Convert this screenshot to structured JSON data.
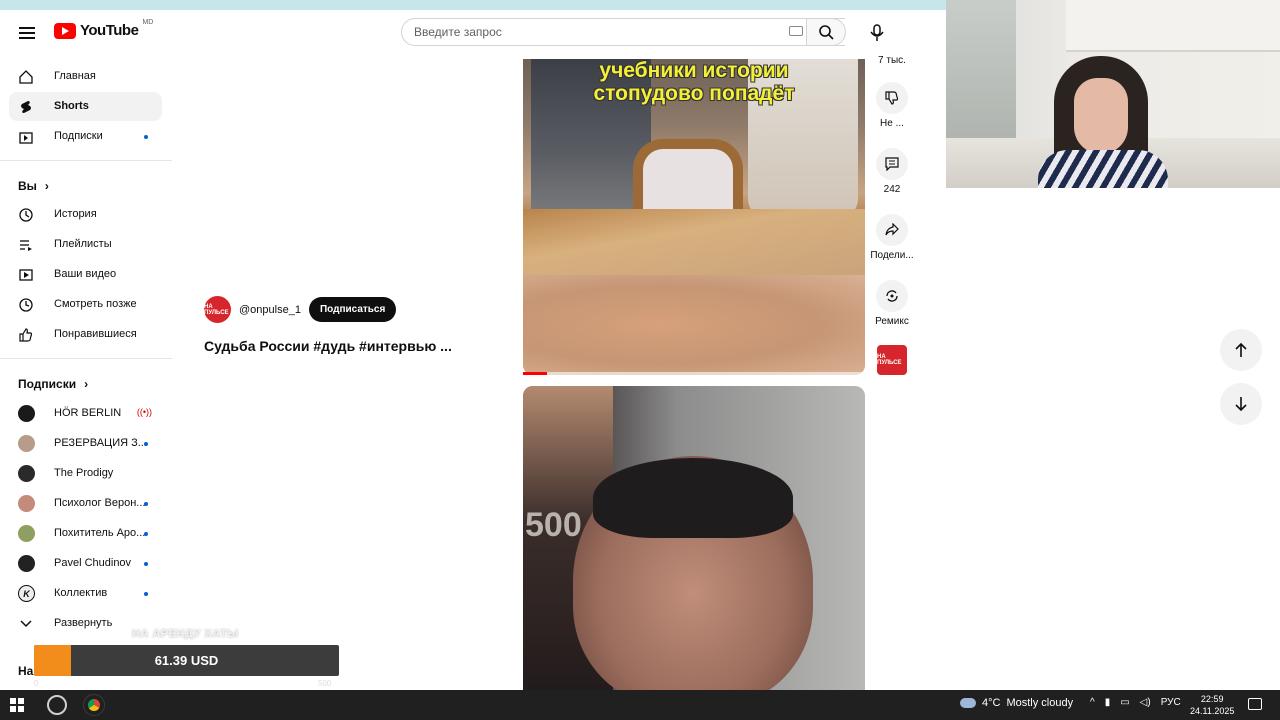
{
  "header": {
    "logo_text": "YouTube",
    "region": "MD",
    "search_placeholder": "Введите запрос"
  },
  "sidebar": {
    "main": [
      {
        "label": "Главная",
        "icon": "home-icon"
      },
      {
        "label": "Shorts",
        "icon": "shorts-icon",
        "active": true
      },
      {
        "label": "Подписки",
        "icon": "subscriptions-icon",
        "dot": true
      }
    ],
    "you_title": "Вы",
    "you": [
      {
        "label": "История",
        "icon": "history-icon"
      },
      {
        "label": "Плейлисты",
        "icon": "playlists-icon"
      },
      {
        "label": "Ваши видео",
        "icon": "your-videos-icon"
      },
      {
        "label": "Смотреть позже",
        "icon": "watch-later-icon"
      },
      {
        "label": "Понравившиеся",
        "icon": "liked-icon"
      }
    ],
    "subs_title": "Подписки",
    "subs": [
      {
        "label": "HÖR BERLIN",
        "live": true,
        "color": "#1a1a1a"
      },
      {
        "label": "РЕЗЕРВАЦИЯ З...",
        "dot": true,
        "color": "#b79c8a"
      },
      {
        "label": "The Prodigy",
        "color": "#2a2a2a"
      },
      {
        "label": "Психолог Верон...",
        "dot": true,
        "color": "#c48a7a"
      },
      {
        "label": "Похититель Аро...",
        "dot": true,
        "color": "#8ea060"
      },
      {
        "label": "Pavel Chudinov",
        "dot": true,
        "color": "#222222"
      },
      {
        "label": "Коллектив",
        "dot": true,
        "color": "#eeeeee"
      }
    ],
    "expand_label": "Развернуть",
    "next_section_partial": "На"
  },
  "short": {
    "channel": "@onpulse_1",
    "subscribe": "Подписаться",
    "title": "Судьба России #дудь #интервью ...",
    "caption_line1": "учебники истории",
    "caption_line2": "стопудово попадёт",
    "progress": 0.07,
    "overlay_number": "500",
    "channel_logo_text": "НА ПУЛЬСЕ"
  },
  "actions": {
    "likes_partial": "7 тыс.",
    "dislike": "Не ...",
    "comments": "242",
    "share": "Подели...",
    "remix": "Ремикс"
  },
  "overlay": {
    "label": "НА АРЕНДУ ХАТЫ",
    "value": "61.39 USD",
    "min": "0",
    "max": "500",
    "fill_fraction": 0.12
  },
  "taskbar": {
    "weather_temp": "4°C",
    "weather_text": "Mostly cloudy",
    "lang": "РУС",
    "time": "22:59",
    "date": "24.11.2025"
  }
}
